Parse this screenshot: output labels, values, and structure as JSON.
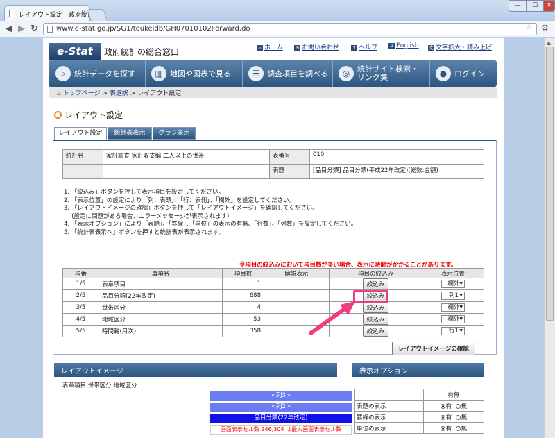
{
  "browser": {
    "tab_title": "レイアウト設定　政府統計",
    "url": "www.e-stat.go.jp/SG1/toukeidb/GH07010102Forward.do",
    "close_glyph": "x",
    "min_glyph": "—",
    "max_glyph": "☐",
    "winclose_glyph": "✕"
  },
  "header": {
    "logo": "e-Stat",
    "site_name": "政府統計の総合窓口",
    "links": [
      "ホーム",
      "お問い合わせ",
      "ヘルプ",
      "English",
      "文字拡大・読み上げ"
    ]
  },
  "menu": [
    "統計データを探す",
    "地図や図表で見る",
    "調査項目を調べる",
    "統計サイト検索・リンク集",
    "ログイン"
  ],
  "breadcrumb": {
    "items": [
      "トップページ",
      "表選択"
    ],
    "current": "レイアウト設定",
    "sep": ">"
  },
  "page_title": "レイアウト設定",
  "tabs": [
    "レイアウト設定",
    "統計表表示",
    "グラフ表示"
  ],
  "info": {
    "name_label": "統計名",
    "name_value": "家計調査 家計収支編 二人以上の世帯",
    "num_label": "表番号",
    "num_value": "010",
    "table_label": "表題",
    "table_value": "[品目分類] 品目分類(平成22年改定)(総数:金額)"
  },
  "instructions": [
    "1. 「絞込み」ボタンを押して表示項目を設定してください。",
    "2. 「表示位置」の設定により「列：表頭」、「行：表側」、「欄外」を設定してください。",
    "3. 「レイアウトイメージの確認」ボタンを押して「レイアウトイメージ」を確認してください。",
    "　 (設定に問題がある場合、エラーメッセージが表示されます)",
    "4. 「表示オプション」により「表題」、「罫線」、「単位」の表示の有無、「行数」、「列数」を設定してください。",
    "5. 「統計表表示へ」ボタンを押すと統計表が表示されます。"
  ],
  "notice": "※項目の絞込みにおいて項目数が多い場合、表示に時間がかかることがあります。",
  "items_table": {
    "headers": [
      "項番",
      "事項名",
      "項目数",
      "解説表示",
      "項目の絞込み",
      "表示位置"
    ],
    "button_label": "絞込み",
    "rows": [
      {
        "no": "1/5",
        "name": "表章項目",
        "count": "1",
        "pos": "欄外"
      },
      {
        "no": "2/5",
        "name": "品目分類(22年改定)",
        "count": "688",
        "pos": "列1"
      },
      {
        "no": "3/5",
        "name": "世帯区分",
        "count": "4",
        "pos": "欄外"
      },
      {
        "no": "4/5",
        "name": "地域区分",
        "count": "53",
        "pos": "欄外"
      },
      {
        "no": "5/5",
        "name": "時間軸(月次)",
        "count": "358",
        "pos": "行1"
      }
    ]
  },
  "layout_button": "レイアウトイメージの確認",
  "layout_image": {
    "header": "レイアウトイメージ",
    "subtitle": "表章項目 世帯区分 地域区分",
    "col3": "<列3>",
    "col2": "<列2>",
    "col1": "品目分類(22年改定)",
    "cell_note": "画面表示セル数 246,304 は最大画面表示セル数"
  },
  "options": {
    "header": "表示オプション",
    "col_header": "有無",
    "yes": "有",
    "no": "無",
    "rows": [
      "表題の表示",
      "罫線の表示",
      "単位の表示"
    ]
  },
  "colors": {
    "accent_blue": "#2c567f",
    "highlight": "#f03c80",
    "notice_red": "#ee0000"
  }
}
